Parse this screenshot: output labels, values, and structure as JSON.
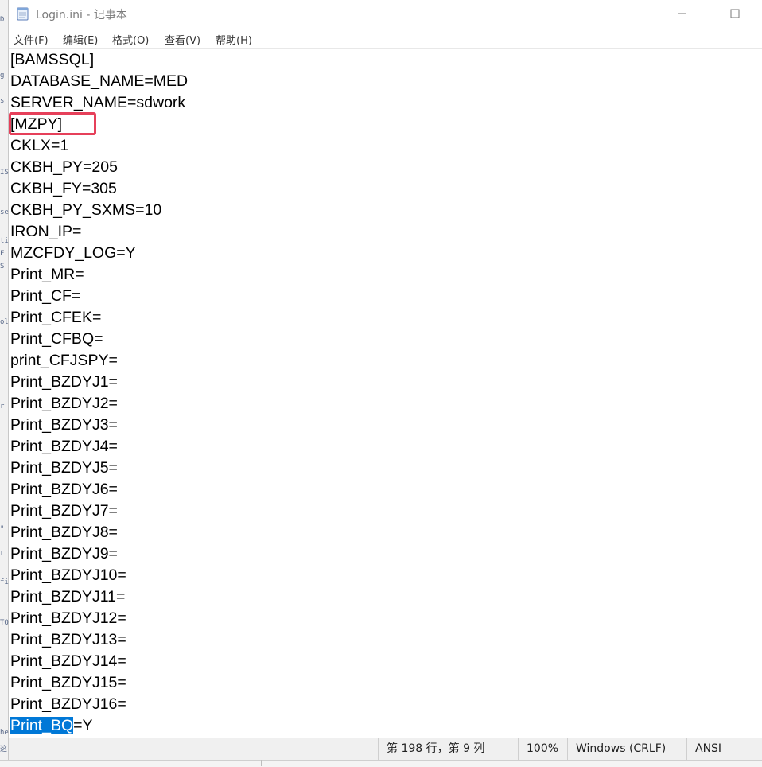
{
  "window": {
    "title": "Login.ini - 记事本"
  },
  "icons": {
    "app": "notepad-icon",
    "minimize": "minimize-icon",
    "maximize": "maximize-icon"
  },
  "menu": {
    "items": [
      "文件(F)",
      "编辑(E)",
      "格式(O)",
      "查看(V)",
      "帮助(H)"
    ]
  },
  "editor": {
    "lines": [
      "[BAMSSQL]",
      "DATABASE_NAME=MED",
      "SERVER_NAME=sdwork",
      "[MZPY]",
      "CKLX=1",
      "CKBH_PY=205",
      "CKBH_FY=305",
      "CKBH_PY_SXMS=10",
      "IRON_IP=",
      "MZCFDY_LOG=Y",
      "Print_MR=",
      "Print_CF=",
      "Print_CFEK=",
      "Print_CFBQ=",
      "print_CFJSPY=",
      "Print_BZDYJ1=",
      "Print_BZDYJ2=",
      "Print_BZDYJ3=",
      "Print_BZDYJ4=",
      "Print_BZDYJ5=",
      "Print_BZDYJ6=",
      "Print_BZDYJ7=",
      "Print_BZDYJ8=",
      "Print_BZDYJ9=",
      "Print_BZDYJ10=",
      "Print_BZDYJ11=",
      "Print_BZDYJ12=",
      "Print_BZDYJ13=",
      "Print_BZDYJ14=",
      "Print_BZDYJ15=",
      "Print_BZDYJ16="
    ],
    "last_line_selected": "Print_BQ",
    "last_line_rest": "=Y",
    "highlighted_line_index": 3,
    "highlight_color": "#e6405a",
    "selection_color": "#0078d7"
  },
  "statusbar": {
    "position": "第 198 行，第 9 列",
    "zoom": "100%",
    "line_ending": "Windows (CRLF)",
    "encoding": "ANSI"
  },
  "background_fragments": [
    "D",
    "g",
    "s",
    "IS",
    "se",
    "ti",
    "F",
    "S",
    "ol",
    "r",
    "\"",
    "r",
    "fi",
    "TO",
    "he",
    "这"
  ]
}
